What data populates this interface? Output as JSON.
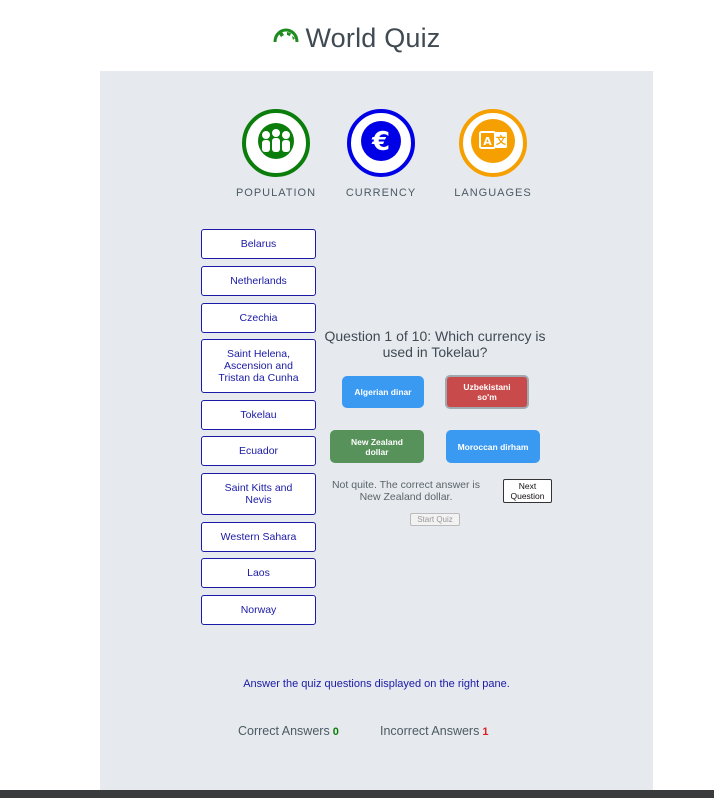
{
  "header": {
    "title": "World Quiz",
    "logo_icon": "globe-icon"
  },
  "categories": [
    {
      "label": "POPULATION",
      "icon": "people-icon",
      "color": "#0b7d0b"
    },
    {
      "label": "CURRENCY",
      "icon": "euro-icon",
      "color": "#0000e6"
    },
    {
      "label": "LANGUAGES",
      "icon": "translate-icon",
      "color": "#f5a000"
    }
  ],
  "countries": [
    "Belarus",
    "Netherlands",
    "Czechia",
    "Saint Helena, Ascension and Tristan da Cunha",
    "Tokelau",
    "Ecuador",
    "Saint Kitts and Nevis",
    "Western Sahara",
    "Laos",
    "Norway"
  ],
  "quiz": {
    "question": "Question 1 of 10: Which currency is used in Tokelau?",
    "answers": [
      {
        "label": "Algerian dinar",
        "state": "neutral"
      },
      {
        "label": "Uzbekistani so'm",
        "state": "wrong"
      },
      {
        "label": "New Zealand dollar",
        "state": "correct"
      },
      {
        "label": "Moroccan dirham",
        "state": "neutral"
      }
    ],
    "feedback": "Not quite. The correct answer is New Zealand dollar.",
    "next_label": "Next Question",
    "start_label": "Start Quiz"
  },
  "instructions": "Answer the quiz questions displayed on the right pane.",
  "score": {
    "correct_label": "Correct Answers",
    "correct_value": "0",
    "incorrect_label": "Incorrect Answers",
    "incorrect_value": "1"
  },
  "colors": {
    "correct": "#0b7d0b",
    "incorrect": "#e02020",
    "answer_blue": "#3a9af2",
    "answer_green": "#56925a",
    "answer_red": "#c94a4a"
  }
}
